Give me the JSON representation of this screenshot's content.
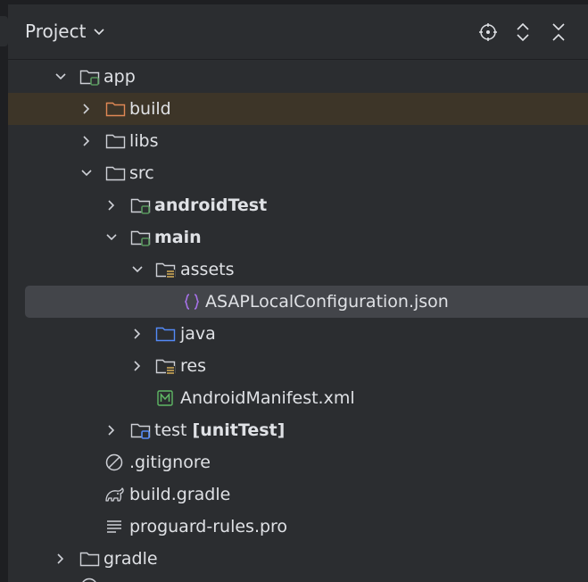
{
  "header": {
    "title": "Project"
  },
  "tree": {
    "app": "app",
    "build": "build",
    "libs": "libs",
    "src": "src",
    "androidTest": "androidTest",
    "main": "main",
    "assets": "assets",
    "asap_json": "ASAPLocalConfiguration.json",
    "java": "java",
    "res": "res",
    "manifest": "AndroidManifest.xml",
    "test": "test",
    "test_suffix": "[unitTest]",
    "gitignore": ".gitignore",
    "build_gradle": "build.gradle",
    "proguard": "proguard-rules.pro",
    "gradle": "gradle"
  },
  "colors": {
    "folder": "#ced0d6",
    "excluded_folder": "#e08855",
    "module_badge": "#57965c",
    "test_badge": "#548af7",
    "source_folder": "#548af7",
    "json_icon": "#a571e6",
    "manifest_icon": "#5fb865",
    "resource_lines": "#d6ae58"
  }
}
